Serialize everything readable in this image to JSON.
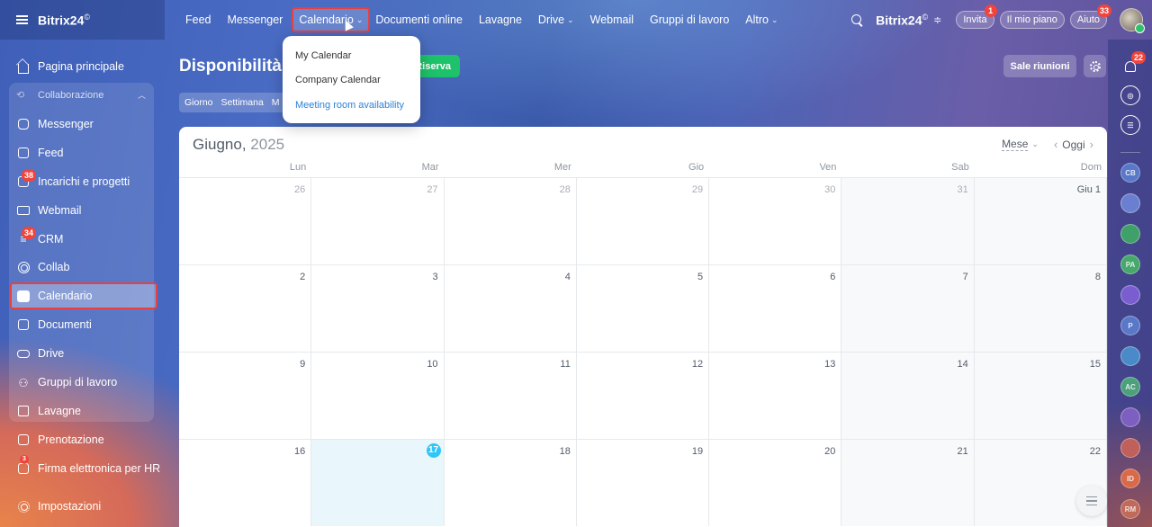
{
  "app": {
    "logo": "Bitrix24",
    "logo_mark": "©",
    "brand_right": "Bitrix24",
    "brand_right_mark": "©"
  },
  "topnav": {
    "items": [
      {
        "label": "Feed"
      },
      {
        "label": "Messenger"
      },
      {
        "label": "Calendario",
        "chevron": "⌄"
      },
      {
        "label": "Documenti online"
      },
      {
        "label": "Lavagne"
      },
      {
        "label": "Drive",
        "chevron": "⌄"
      },
      {
        "label": "Webmail"
      },
      {
        "label": "Gruppi di lavoro"
      },
      {
        "label": "Altro",
        "chevron": "⌄"
      }
    ],
    "invite": {
      "label": "Invita",
      "badge": "1"
    },
    "plan": {
      "label": "Il mio piano"
    },
    "help": {
      "label": "Aiuto",
      "badge": "33"
    }
  },
  "dropdown": {
    "items": [
      {
        "label": "My Calendar"
      },
      {
        "label": "Company Calendar"
      },
      {
        "label": "Meeting room availability"
      }
    ]
  },
  "sidebar": {
    "home": "Pagina principale",
    "group_label": "Collaborazione",
    "items": [
      {
        "label": "Messenger",
        "icon": "chat-icon"
      },
      {
        "label": "Feed",
        "icon": "feed-icon"
      },
      {
        "label": "Incarichi e progetti",
        "icon": "tasks-icon",
        "badge": "38"
      },
      {
        "label": "Webmail",
        "icon": "mail-icon"
      },
      {
        "label": "CRM",
        "icon": "crm-icon",
        "badge": "34"
      },
      {
        "label": "Collab",
        "icon": "collab-icon"
      },
      {
        "label": "Calendario",
        "icon": "calendar-icon"
      },
      {
        "label": "Documenti",
        "icon": "documents-icon"
      },
      {
        "label": "Drive",
        "icon": "drive-icon"
      },
      {
        "label": "Gruppi di lavoro",
        "icon": "workgroups-icon"
      },
      {
        "label": "Lavagne",
        "icon": "boards-icon"
      }
    ],
    "extra": [
      {
        "label": "Prenotazione",
        "icon": "booking-icon"
      },
      {
        "label": "Firma elettronica per HR",
        "icon": "signature-icon",
        "badge": "3"
      }
    ],
    "settings": "Impostazioni"
  },
  "header": {
    "title": "Disponibilità s",
    "reserve_button": "Riserva",
    "rooms_button": "Sale riunioni",
    "view_tabs": [
      "Giorno",
      "Settimana",
      "M"
    ]
  },
  "calendar": {
    "month": "Giugno,",
    "year": "2025",
    "view_select": "Mese",
    "today_button": "Oggi",
    "weekdays": [
      "Lun",
      "Mar",
      "Mer",
      "Gio",
      "Ven",
      "Sab",
      "Dom"
    ],
    "weeks": [
      [
        "26",
        "27",
        "28",
        "29",
        "30",
        "31",
        "Giu 1"
      ],
      [
        "2",
        "3",
        "4",
        "5",
        "6",
        "7",
        "8"
      ],
      [
        "9",
        "10",
        "11",
        "12",
        "13",
        "14",
        "15"
      ],
      [
        "16",
        "17",
        "18",
        "19",
        "20",
        "21",
        "22"
      ]
    ],
    "today": "17"
  },
  "rail": {
    "notifications_badge": "22",
    "avatars": [
      "CB",
      "",
      "",
      "PA",
      "",
      "P",
      "",
      "AC",
      "",
      "",
      "ID",
      "RM"
    ]
  },
  "colors": {
    "accent_green": "#1ec26a",
    "highlight_red": "#e84040",
    "today_blue": "#2fc6f6",
    "link_blue": "#2b82d8"
  }
}
